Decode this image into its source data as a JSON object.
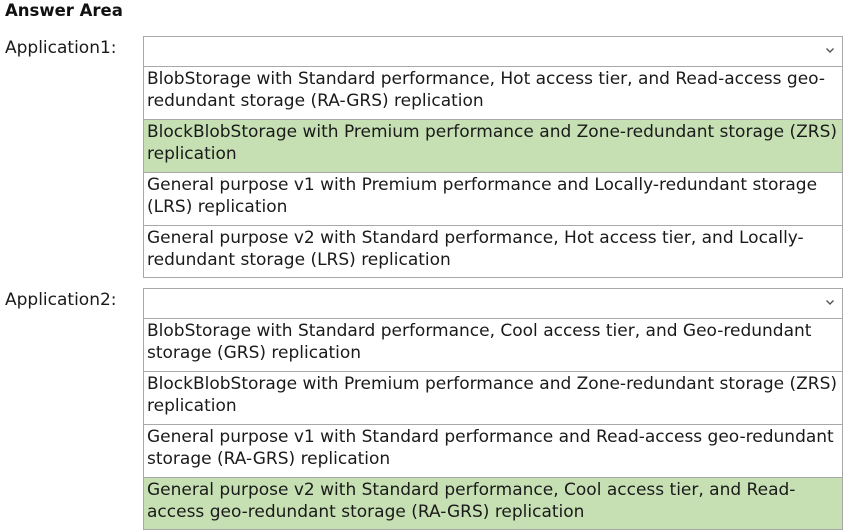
{
  "title": "Answer Area",
  "colors": {
    "selected_background": "#c6e0b4",
    "border": "#a8a8a8"
  },
  "icons": {
    "dropdown": "chevron-down-icon"
  },
  "applications": [
    {
      "label": "Application1:",
      "selected_value": "",
      "options": [
        "BlobStorage with Standard performance, Hot access tier, and Read-access geo-redundant storage (RA-GRS) replication",
        "BlockBlobStorage with Premium performance and Zone-redundant storage (ZRS) replication",
        "General purpose v1 with Premium performance and Locally-redundant storage (LRS) replication",
        "General purpose v2 with Standard performance, Hot access tier, and Locally-redundant storage (LRS) replication"
      ],
      "highlighted_option_index": 1
    },
    {
      "label": "Application2:",
      "selected_value": "",
      "options": [
        "BlobStorage with Standard performance, Cool access tier, and Geo-redundant storage (GRS) replication",
        "BlockBlobStorage with Premium performance and Zone-redundant storage (ZRS) replication",
        "General purpose v1 with Standard performance and Read-access geo-redundant storage (RA-GRS) replication",
        "General purpose v2 with Standard performance, Cool access tier, and Read-access geo-redundant storage (RA-GRS) replication"
      ],
      "highlighted_option_index": 3
    }
  ]
}
